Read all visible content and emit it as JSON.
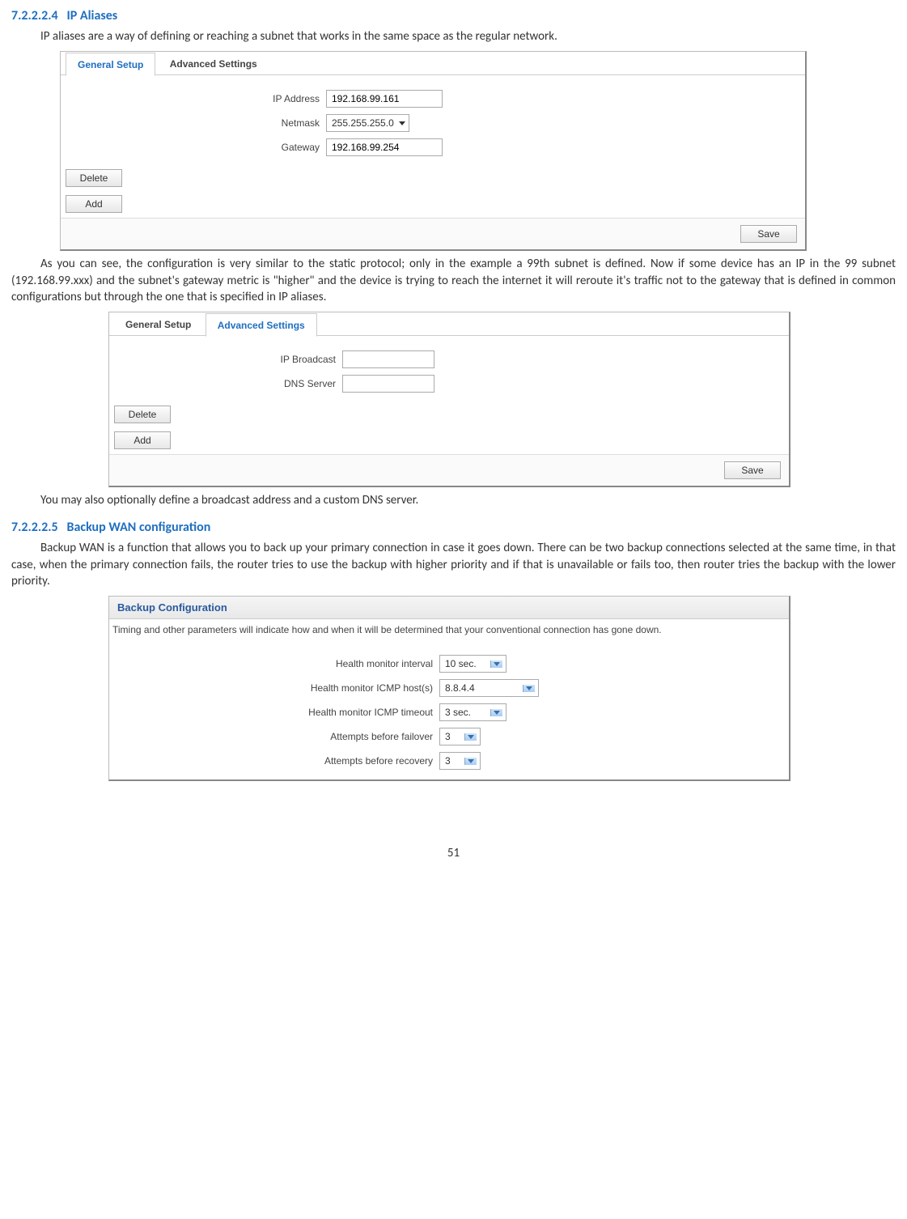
{
  "headings": {
    "h1_num": "7.2.2.2.4",
    "h1_text": "IP Aliases",
    "h2_num": "7.2.2.2.5",
    "h2_text": "Backup WAN configuration"
  },
  "paragraphs": {
    "p1": "IP aliases are a way of defining or reaching a subnet that works in the same space as the regular network.",
    "p2": "As you can see, the configuration is very similar to the static protocol; only in the example a 99th subnet is defined. Now if some device has an IP in the 99 subnet (192.168.99.xxx) and the subnet's gateway metric is \"higher\" and the device is trying to reach the internet it will reroute it's traffic not to the gateway that is defined in common configurations but through the one that is specified in IP aliases.",
    "p3": "You may also optionally define a broadcast address and a custom DNS server.",
    "p4": "Backup WAN is a function that allows you to back up your primary connection in case it goes down. There can be two backup connections selected at the same time, in that case, when the primary connection fails, the router tries to use the backup with higher priority and if that is unavailable or fails too, then router tries the backup with the lower priority."
  },
  "panel1": {
    "tabs": {
      "general": "General Setup",
      "advanced": "Advanced Settings"
    },
    "fields": {
      "ip_label": "IP Address",
      "ip_value": "192.168.99.161",
      "netmask_label": "Netmask",
      "netmask_value": "255.255.255.0",
      "gateway_label": "Gateway",
      "gateway_value": "192.168.99.254"
    },
    "buttons": {
      "delete": "Delete",
      "add": "Add",
      "save": "Save"
    }
  },
  "panel2": {
    "tabs": {
      "general": "General Setup",
      "advanced": "Advanced Settings"
    },
    "fields": {
      "broadcast_label": "IP Broadcast",
      "broadcast_value": "",
      "dns_label": "DNS Server",
      "dns_value": ""
    },
    "buttons": {
      "delete": "Delete",
      "add": "Add",
      "save": "Save"
    }
  },
  "panel3": {
    "title": "Backup Configuration",
    "note": "Timing and other parameters will indicate how and when it will be determined that your conventional connection has gone down.",
    "fields": {
      "interval_label": "Health monitor interval",
      "interval_value": "10 sec.",
      "host_label": "Health monitor ICMP host(s)",
      "host_value": "8.8.4.4",
      "timeout_label": "Health monitor ICMP timeout",
      "timeout_value": "3 sec.",
      "failover_label": "Attempts before failover",
      "failover_value": "3",
      "recovery_label": "Attempts before recovery",
      "recovery_value": "3"
    }
  },
  "page_number": "51"
}
